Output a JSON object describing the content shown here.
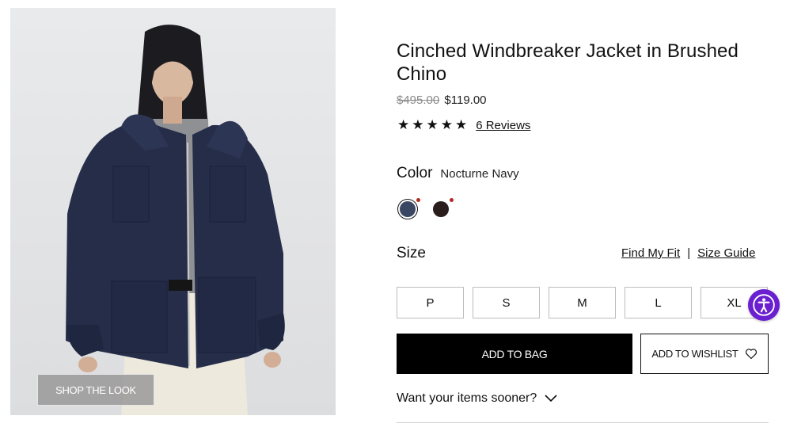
{
  "product": {
    "title": "Cinched Windbreaker Jacket in Brushed Chino",
    "price_original": "$495.00",
    "price_sale": "$119.00",
    "rating_stars": "★★★★★",
    "reviews_link": "6 Reviews"
  },
  "image": {
    "shop_the_look_label": "SHOP THE LOOK"
  },
  "color": {
    "label": "Color",
    "selected_value": "Nocturne Navy",
    "swatches": [
      {
        "name": "Nocturne Navy",
        "hex": "#3a4763",
        "selected": true
      },
      {
        "name": "",
        "hex": "#2a1d1b",
        "selected": false
      }
    ],
    "indicator_color": "#b52a1d"
  },
  "size": {
    "label": "Size",
    "find_my_fit": "Find My Fit",
    "separator": "|",
    "size_guide": "Size Guide",
    "options": [
      "P",
      "S",
      "M",
      "L",
      "XL"
    ]
  },
  "actions": {
    "add_to_bag": "ADD TO BAG",
    "add_to_wishlist": "ADD TO WISHLIST"
  },
  "delivery": {
    "prompt": "Want your items sooner?"
  },
  "colors": {
    "primary_button": "#000000",
    "accessibility_button": "#6a1fd0"
  },
  "icons": [
    "heart-icon",
    "chevron-down-icon",
    "accessibility-icon",
    "star-icon"
  ]
}
